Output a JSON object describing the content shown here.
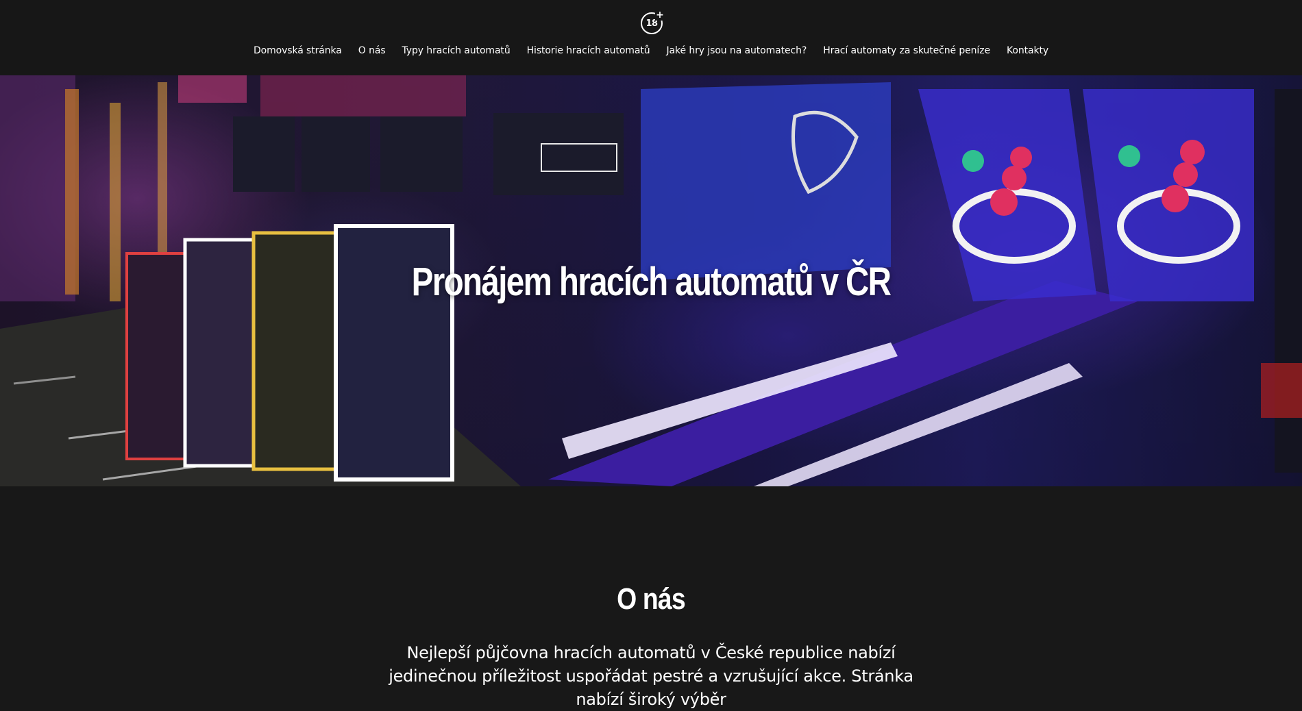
{
  "header": {
    "logo_text": "18",
    "logo_plus": "+",
    "nav": [
      {
        "label": "Domovská stránka"
      },
      {
        "label": "O nás"
      },
      {
        "label": "Typy hracích automatů"
      },
      {
        "label": "Historie hracích automatů"
      },
      {
        "label": "Jaké hry jsou na automatech?"
      },
      {
        "label": "Hrací automaty za skutečné peníze"
      },
      {
        "label": "Kontakty"
      }
    ]
  },
  "hero": {
    "title": "Pronájem hracích automatů v ČR",
    "image_description_icon": "arcade-machines-photo"
  },
  "about": {
    "heading": "O nás",
    "text": "Nejlepší půjčovna hracích automatů v České republice nabízí jedinečnou příležitost uspořádat pestré a vzrušující akce. Stránka nabízí široký výběr"
  },
  "colors": {
    "background": "#181818",
    "text": "#ffffff",
    "neon_purple": "#6a3cff",
    "neon_pink": "#e040a0"
  }
}
